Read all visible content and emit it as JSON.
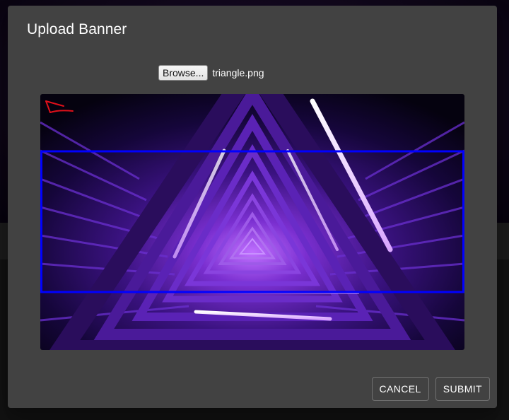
{
  "dialog": {
    "title": "Upload Banner",
    "browse_label": "Browse...",
    "file_name": "triangle.png",
    "cancel_label": "CANCEL",
    "submit_label": "SUBMIT"
  },
  "colors": {
    "dialog_bg": "#424242",
    "crop_frame": "#0000ff",
    "annotation_arrow": "#e0101a",
    "neon_purple": "#8a2be2"
  },
  "icons": {
    "annotation": "red-arrow-icon"
  }
}
